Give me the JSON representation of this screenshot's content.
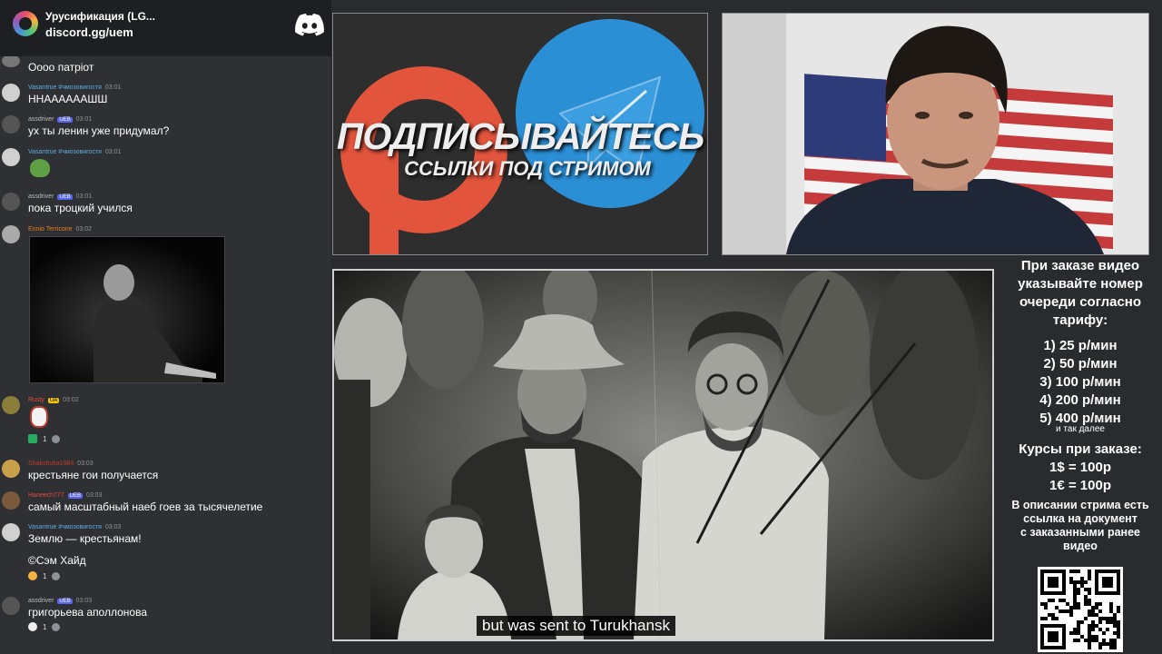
{
  "server": {
    "name": "Урусификация (LG...",
    "link": "discord.gg/uem"
  },
  "messages": [
    {
      "text": "Оооо патріот"
    },
    {
      "user": "Vasantrue #чмозовигостя",
      "time": "03:01",
      "text": "ННААААААШШ"
    },
    {
      "user": "assdriver",
      "badges": [
        "UEB"
      ],
      "time": "03:01",
      "text": "ух ты ленин уже придумал?"
    },
    {
      "user": "Vasantrue #чмозовигостя",
      "time": "03:01"
    },
    {
      "user": "assdriver",
      "badges": [
        "UEB"
      ],
      "time": "03:01",
      "text": "пока троцкий учился"
    },
    {
      "user": "Ennio Terricone",
      "time": "03:02"
    },
    {
      "user": "Rusty",
      "badges": [
        "UA"
      ],
      "time": "03:02",
      "reaction": {
        "count": "1"
      }
    },
    {
      "user": "Shakshuka1984",
      "time": "03:03",
      "text": "крестьяне гои получается"
    },
    {
      "user": "Haneech777",
      "badges": [
        "UEB"
      ],
      "time": "03:03",
      "text": "самый масштабный наеб гоев за тысячелетие"
    },
    {
      "user": "Vasantrue #чмозовигостя",
      "time": "03:03",
      "text": "Землю — крестьянам!",
      "text2": "©Сэм Хайд",
      "reaction": {
        "count": "1"
      }
    },
    {
      "user": "assdriver",
      "badges": [
        "UEB"
      ],
      "time": "03:03",
      "text": "григорьева аполлонова",
      "reaction": {
        "count": "1"
      }
    }
  ],
  "promo": {
    "title": "ПОДПИСЫВАЙТЕСЬ",
    "subtitle": "ССЫЛКИ ПОД СТРИМОМ"
  },
  "video": {
    "subtitle": "but was sent to Turukhansk"
  },
  "info": {
    "heading": [
      "При заказе видео",
      "указывайте номер",
      "очереди согласно",
      "тарифу:"
    ],
    "tariffs": [
      "1) 25 р/мин",
      "2) 50 р/мин",
      "3) 100 р/мин",
      "4) 200 р/мин",
      "5) 400 р/мин"
    ],
    "etc": "и так далее",
    "rates_title": "Курсы при заказе:",
    "rates": [
      "1$ = 100р",
      "1€ = 100р"
    ],
    "description": [
      "В описании стрима есть",
      "ссылка на документ",
      "с заказанными ранее",
      "видео"
    ]
  },
  "colors": {
    "chat_bg": "#2f3033",
    "header_bg": "#1e1f22",
    "vasantrue": "#5dade2",
    "assdriver": "#b9bbbe",
    "ennio": "#e67e22",
    "rusty": "#e74c3c",
    "shakshuka": "#c0392b",
    "haneech": "#e74c3c",
    "patreon": "#f0543c",
    "telegram": "#2aa3df"
  }
}
